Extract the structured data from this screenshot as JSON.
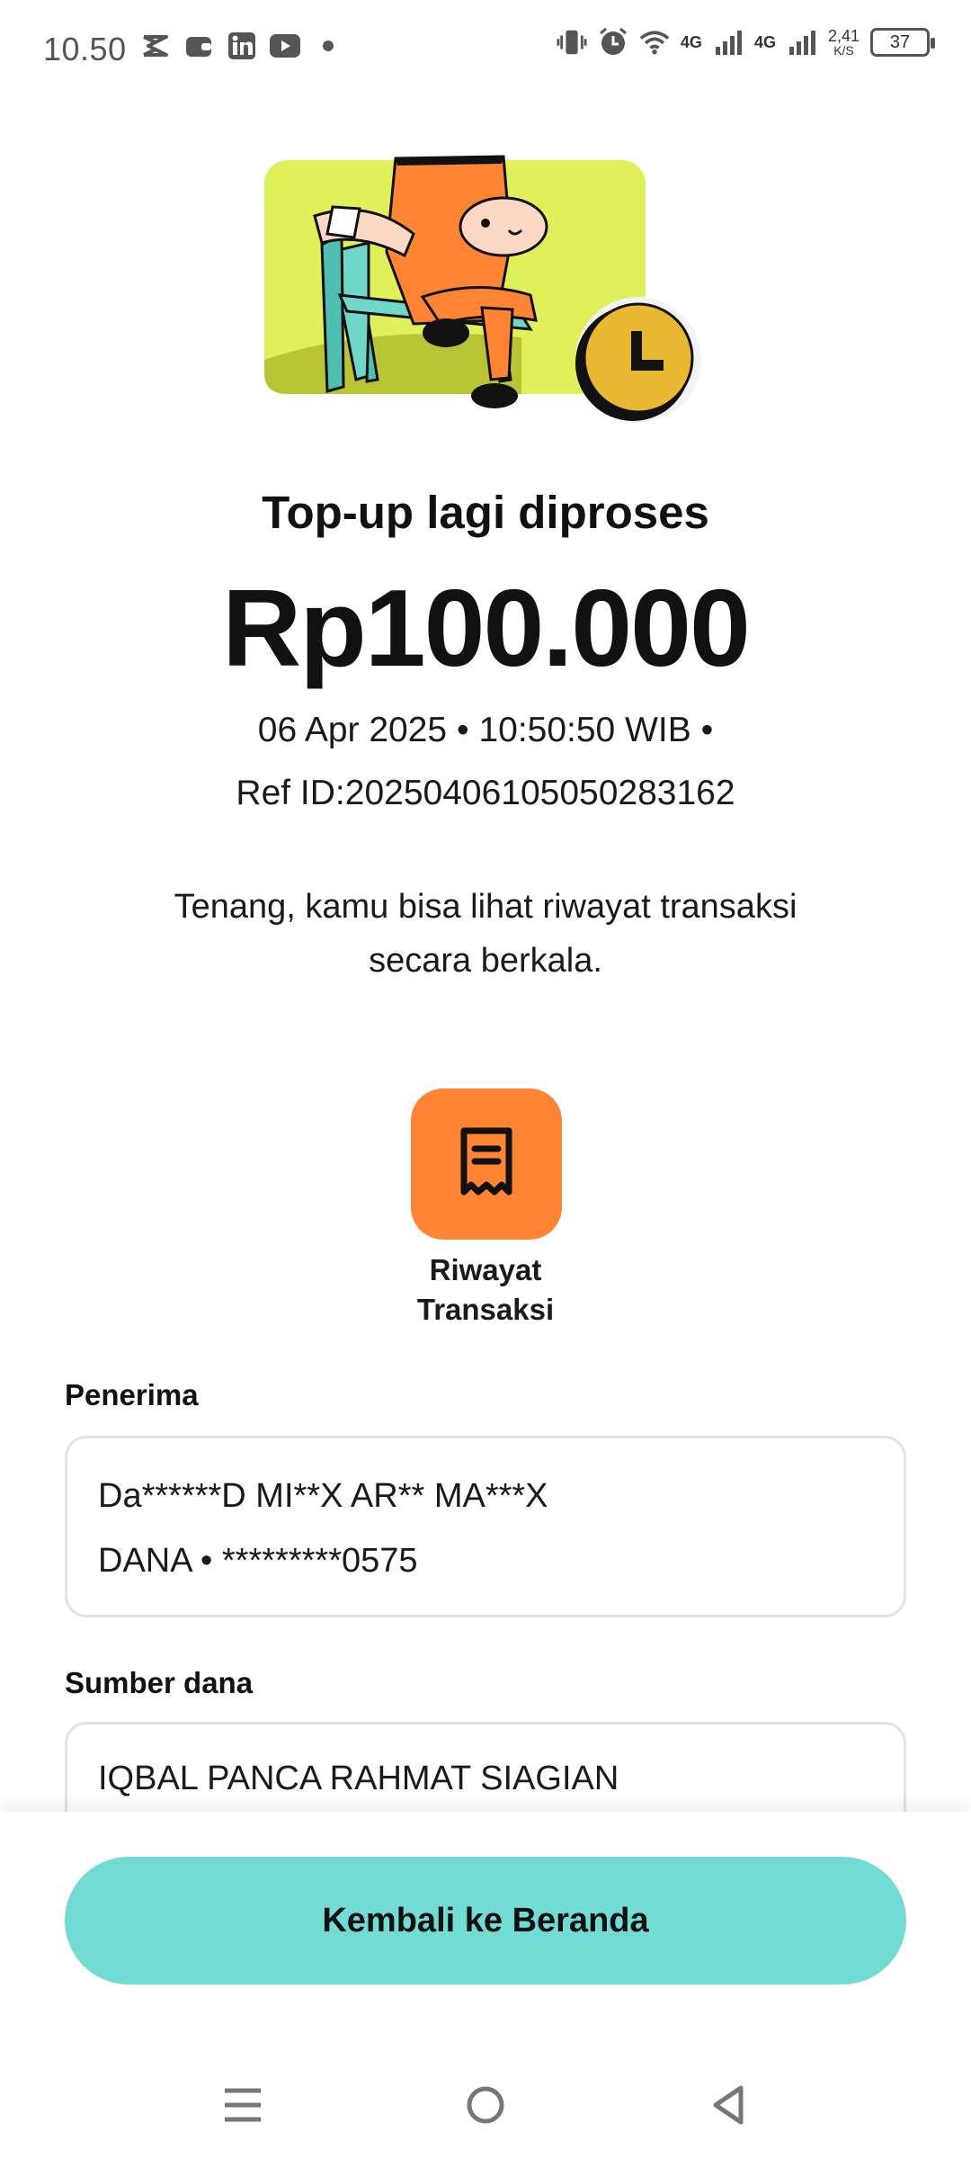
{
  "status_bar": {
    "time": "10.50",
    "network_1": "4G",
    "network_2": "4G",
    "speed_value": "2,41",
    "speed_unit": "K/S",
    "battery": "37"
  },
  "illustration": {
    "icon": "person-waiting-with-clock-illustration",
    "colors": {
      "background": "#dff05a",
      "character": "#ff8434",
      "chair": "#6fd6c8",
      "clock": "#e8b830"
    }
  },
  "main": {
    "title": "Top-up lagi diproses",
    "amount": "Rp100.000",
    "datetime_line": "06 Apr 2025 • 10:50:50 WIB •",
    "ref_line": "Ref ID:20250406105050283162",
    "info_line_1": "Tenang, kamu bisa lihat riwayat transaksi",
    "info_line_2": "secara berkala."
  },
  "history": {
    "icon": "receipt-icon",
    "label_line_1": "Riwayat",
    "label_line_2": "Transaksi",
    "color": "#ff8434"
  },
  "recipient": {
    "label": "Penerima",
    "name": "Da******D MI**X AR** MA***X",
    "account": "DANA • *********0575"
  },
  "source": {
    "label": "Sumber dana",
    "name": "IQBAL PANCA RAHMAT SIAGIAN"
  },
  "footer": {
    "home_button_label": "Kembali ke Beranda",
    "button_color": "#72dcd4"
  },
  "nav": {
    "menu_icon": "menu-icon",
    "home_icon": "home-circle-icon",
    "back_icon": "back-triangle-icon"
  }
}
